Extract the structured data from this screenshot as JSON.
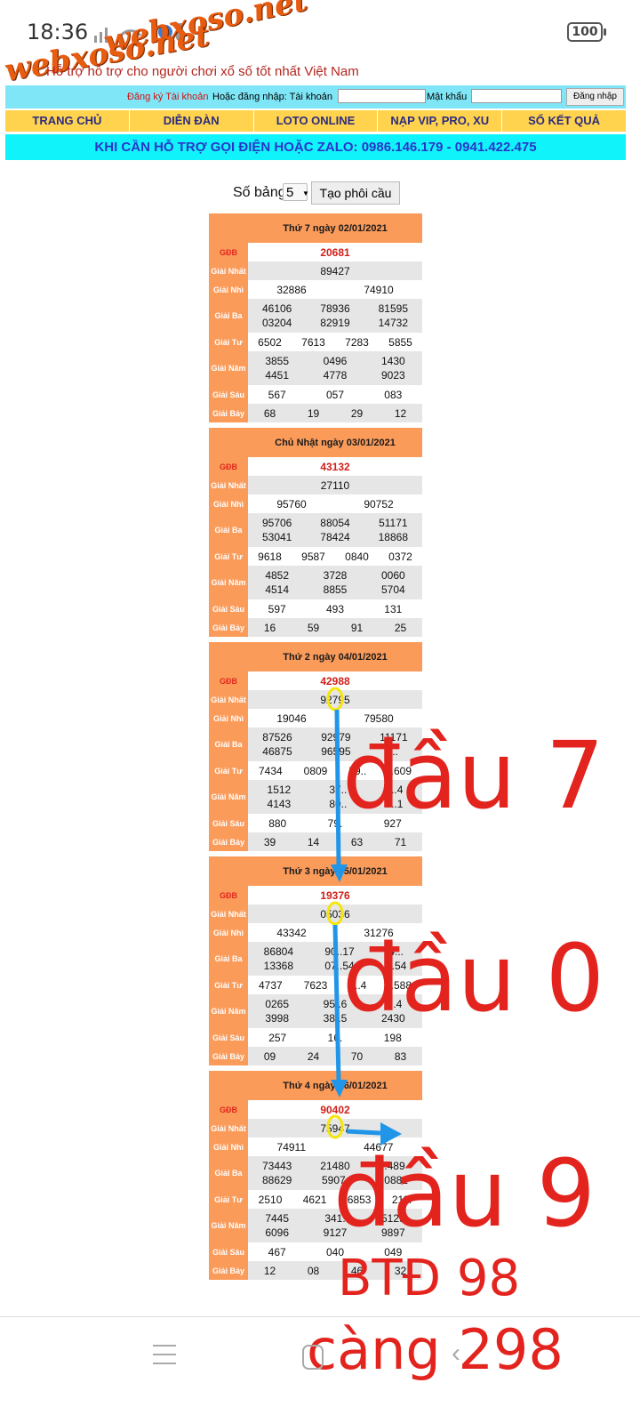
{
  "status_bar": {
    "time": "18:36",
    "battery": "100"
  },
  "site": {
    "logo_text": "webxoso.net",
    "tagline": "Hỗ trợ hỗ trợ cho người chơi xổ số tốt nhất Việt Nam",
    "login": {
      "register_label": "Đăng ký Tài khoản",
      "or_login_label": "Hoặc đăng nhập: Tài khoản",
      "username_value": "",
      "password_label": "Mật khẩu",
      "password_value": "",
      "login_button": "Đăng nhập"
    },
    "nav": [
      "TRANG CHỦ",
      "DIỄN ĐÀN",
      "LOTO ONLINE",
      "NẠP VIP, PRO, XU",
      "SỔ KẾT QUẢ"
    ],
    "hotline": "KHI CẦN HỖ TRỢ GỌI ĐIỆN HOẶC ZALO: 0986.146.179 - 0941.422.475"
  },
  "controls": {
    "label": "Số bảng",
    "selected": "5",
    "button": "Tạo phôi cầu"
  },
  "labels": {
    "db": "GĐB",
    "nhat": "Giải Nhất",
    "nhi": "Giải Nhì",
    "ba": "Giải Ba",
    "tu": "Giải Tư",
    "nam": "Giải Năm",
    "sau": "Giải Sáu",
    "bay": "Giải Bảy"
  },
  "days": [
    {
      "title": "Thứ 7 ngày 02/01/2021",
      "db": "20681",
      "nhat": "89427",
      "nhi": [
        "32886",
        "74910"
      ],
      "ba": [
        [
          "46106",
          "03204"
        ],
        [
          "78936",
          "82919"
        ],
        [
          "81595",
          "14732"
        ]
      ],
      "tu": [
        "6502",
        "7613",
        "7283",
        "5855"
      ],
      "nam": [
        [
          "3855",
          "4451"
        ],
        [
          "0496",
          "4778"
        ],
        [
          "1430",
          "9023"
        ]
      ],
      "sau": [
        "567",
        "057",
        "083"
      ],
      "bay": [
        "68",
        "19",
        "29",
        "12"
      ]
    },
    {
      "title": "Chủ Nhật ngày 03/01/2021",
      "db": "43132",
      "nhat": "27110",
      "nhi": [
        "95760",
        "90752"
      ],
      "ba": [
        [
          "95706",
          "53041"
        ],
        [
          "88054",
          "78424"
        ],
        [
          "51171",
          "18868"
        ]
      ],
      "tu": [
        "9618",
        "9587",
        "0840",
        "0372"
      ],
      "nam": [
        [
          "4852",
          "4514"
        ],
        [
          "3728",
          "8855"
        ],
        [
          "0060",
          "5704"
        ]
      ],
      "sau": [
        "597",
        "493",
        "131"
      ],
      "bay": [
        "16",
        "59",
        "91",
        "25"
      ]
    },
    {
      "title": "Thứ 2 ngày 04/01/2021",
      "db": "42988",
      "nhat": "92795",
      "nhi": [
        "19046",
        "79580"
      ],
      "ba": [
        [
          "87526",
          "46875"
        ],
        [
          "92979",
          "96595"
        ],
        [
          "11171",
          "..."
        ]
      ],
      "tu": [
        "7434",
        "0809",
        "59..",
        "..609"
      ],
      "nam": [
        [
          "1512",
          "4143"
        ],
        [
          "37..",
          "80.."
        ],
        [
          "3..4",
          "9..1"
        ]
      ],
      "sau": [
        "880",
        "79.",
        "927"
      ],
      "bay": [
        "39",
        "14",
        "63",
        "71"
      ]
    },
    {
      "title": "Thứ 3 ngày 05/01/2021",
      "db": "19376",
      "nhat": "05036",
      "nhi": [
        "43342",
        "31276"
      ],
      "ba": [
        [
          "86804",
          "13368"
        ],
        [
          "90..17",
          "07..54"
        ],
        [
          "4...",
          "...54"
        ]
      ],
      "tu": [
        "4737",
        "7623",
        "5..4",
        "..588"
      ],
      "nam": [
        [
          "0265",
          "3998"
        ],
        [
          "95..6",
          "38..5"
        ],
        [
          "2..4",
          "2430"
        ]
      ],
      "sau": [
        "257",
        "16.",
        "198"
      ],
      "bay": [
        "09",
        "24",
        "70",
        "83"
      ]
    },
    {
      "title": "Thứ 4 ngày 06/01/2021",
      "db": "90402",
      "nhat": "75947",
      "nhi": [
        "74911",
        "44677"
      ],
      "ba": [
        [
          "73443",
          "88629"
        ],
        [
          "21480",
          "5907."
        ],
        [
          "..489",
          "..0881"
        ]
      ],
      "tu": [
        "2510",
        "4621",
        "6853",
        "211."
      ],
      "nam": [
        [
          "7445",
          "6096"
        ],
        [
          "341.",
          "9127"
        ],
        [
          "5129",
          "9897"
        ]
      ],
      "sau": [
        "467",
        "040",
        "049"
      ],
      "bay": [
        "12",
        "08",
        "46",
        "32"
      ]
    }
  ],
  "annotations": {
    "dau7": "đầu 7",
    "dau0": "đầu 0",
    "dau9": "đầu 9",
    "btd": "BTĐ 98",
    "cang": "càng 298",
    "arrow_color": "#2196e8",
    "circle_color": "#f5e50a",
    "text_color": "#e3241e"
  }
}
